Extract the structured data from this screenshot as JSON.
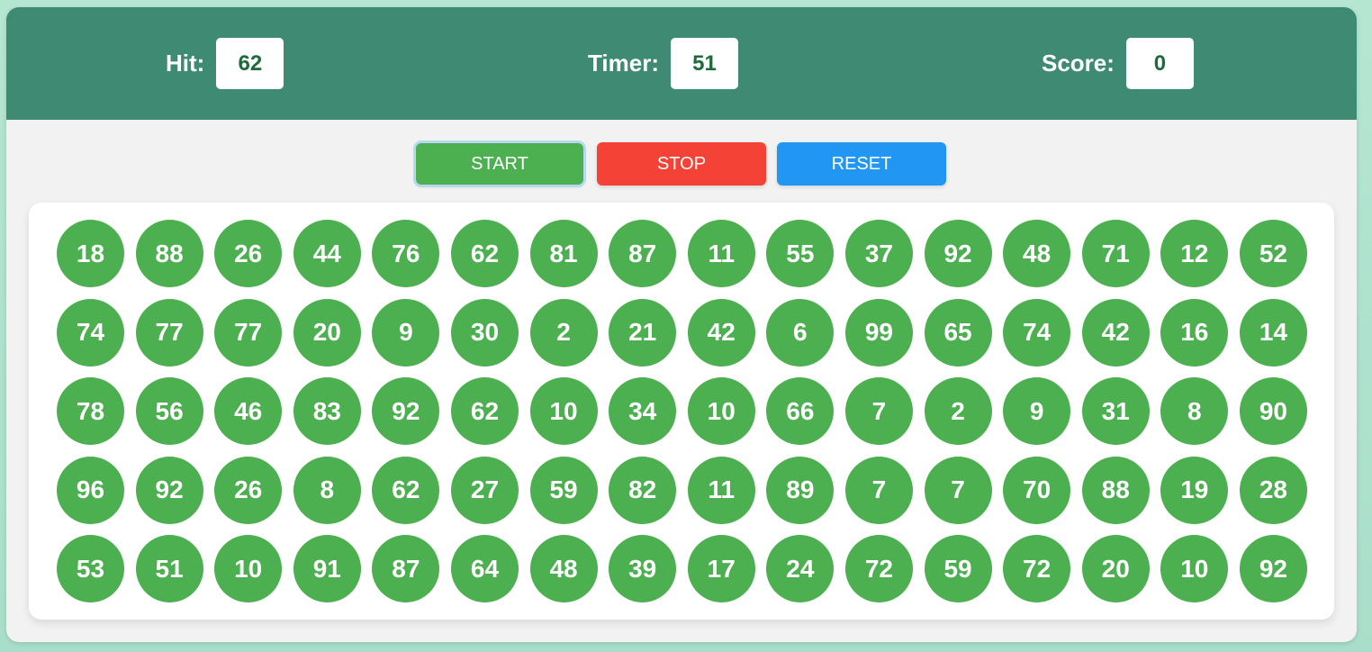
{
  "stats": {
    "hit_label": "Hit:",
    "hit_value": "62",
    "timer_label": "Timer:",
    "timer_value": "51",
    "score_label": "Score:",
    "score_value": "0"
  },
  "controls": {
    "start_label": "START",
    "stop_label": "STOP",
    "reset_label": "RESET"
  },
  "colors": {
    "header": "#3e8a72",
    "bubble": "#4caf50",
    "start": "#4caf50",
    "stop": "#f44336",
    "reset": "#2196f3"
  },
  "bubbles": [
    18,
    88,
    26,
    44,
    76,
    62,
    81,
    87,
    11,
    55,
    37,
    92,
    48,
    71,
    12,
    52,
    74,
    77,
    77,
    20,
    9,
    30,
    2,
    21,
    42,
    6,
    99,
    65,
    74,
    42,
    16,
    14,
    78,
    56,
    46,
    83,
    92,
    62,
    10,
    34,
    10,
    66,
    7,
    2,
    9,
    31,
    8,
    90,
    96,
    92,
    26,
    8,
    62,
    27,
    59,
    82,
    11,
    89,
    7,
    7,
    70,
    88,
    19,
    28,
    53,
    51,
    10,
    91,
    87,
    64,
    48,
    39,
    17,
    24,
    72,
    59,
    72,
    20,
    10,
    92
  ]
}
